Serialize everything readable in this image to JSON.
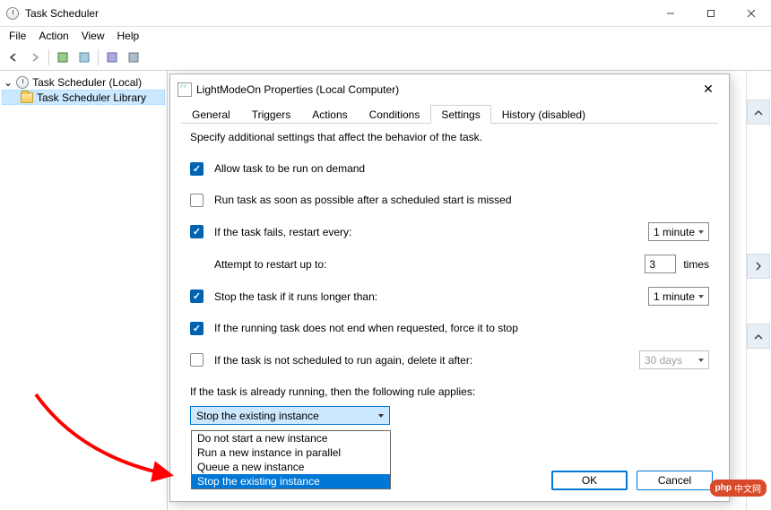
{
  "titlebar": {
    "app_name": "Task Scheduler"
  },
  "menubar": {
    "items": [
      "File",
      "Action",
      "View",
      "Help"
    ]
  },
  "tree": {
    "root": "Task Scheduler (Local)",
    "child": "Task Scheduler Library"
  },
  "dialog": {
    "title": "LightModeOn Properties (Local Computer)",
    "tabs": [
      "General",
      "Triggers",
      "Actions",
      "Conditions",
      "Settings",
      "History (disabled)"
    ],
    "active_tab": "Settings",
    "description": "Specify additional settings that affect the behavior of the task.",
    "settings": {
      "allow_on_demand": "Allow task to be run on demand",
      "run_asap": "Run task as soon as possible after a scheduled start is missed",
      "restart_every": "If the task fails, restart every:",
      "restart_interval": "1 minute",
      "attempt_restart": "Attempt to restart up to:",
      "attempt_count": "3",
      "attempt_times": "times",
      "stop_longer": "Stop the task if it runs longer than:",
      "stop_longer_value": "1 minute",
      "force_stop": "If the running task does not end when requested, force it to stop",
      "delete_after": "If the task is not scheduled to run again, delete it after:",
      "delete_after_value": "30 days",
      "rule_label": "If the task is already running, then the following rule applies:",
      "rule_selected": "Stop the existing instance",
      "rule_options": [
        "Do not start a new instance",
        "Run a new instance in parallel",
        "Queue a new instance",
        "Stop the existing instance"
      ]
    },
    "buttons": {
      "ok": "OK",
      "cancel": "Cancel"
    }
  },
  "watermark": "中文网"
}
